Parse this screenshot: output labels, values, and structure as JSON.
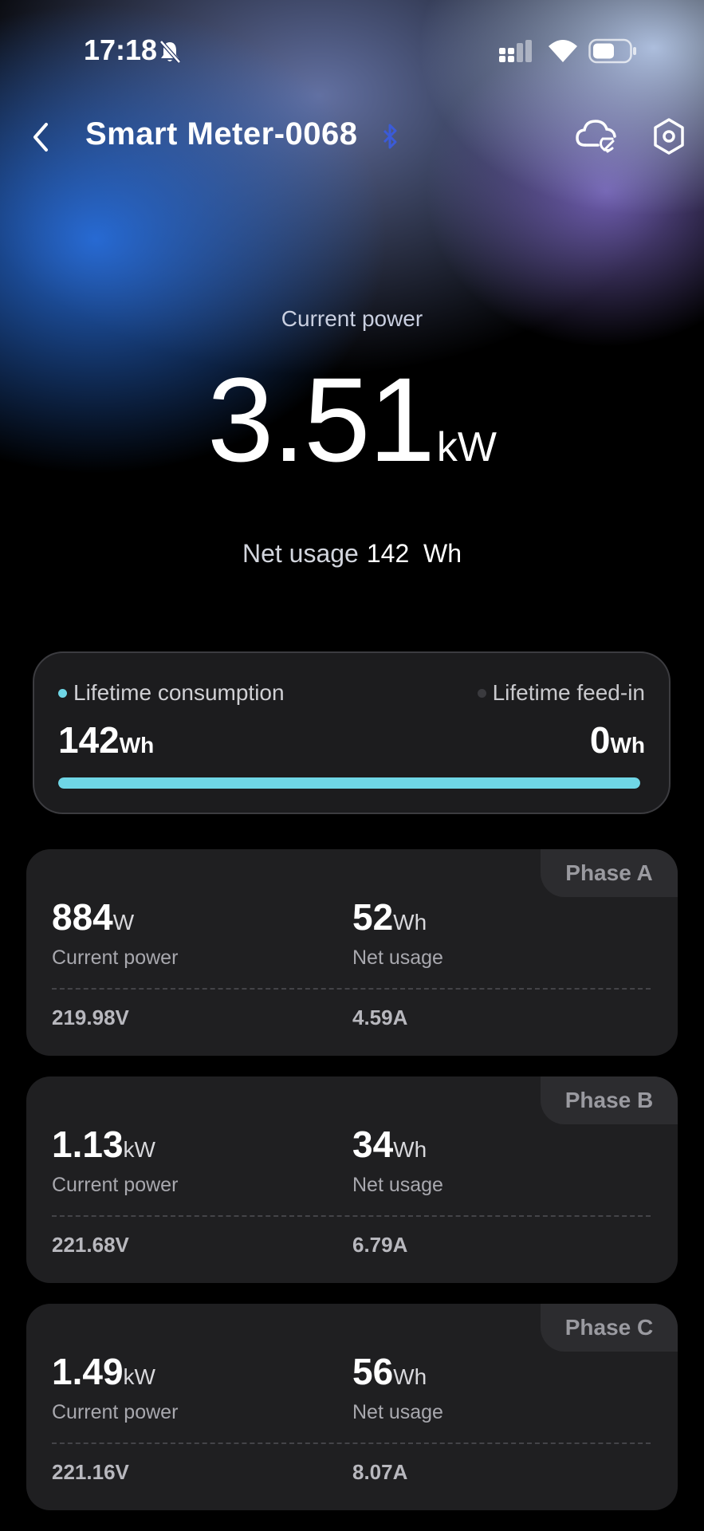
{
  "status_bar": {
    "time": "17:18",
    "icons": [
      "bell-muted-icon",
      "signal-icon",
      "wifi-icon",
      "battery-icon"
    ]
  },
  "header": {
    "title": "Smart Meter-0068",
    "icons": [
      "back-icon",
      "bluetooth-icon",
      "cloud-sync-icon",
      "settings-icon"
    ]
  },
  "hero": {
    "label": "Current power",
    "value": "3.51",
    "unit": "kW",
    "net_usage_label": "Net usage",
    "net_usage_value": "142  Wh"
  },
  "lifetime": {
    "consumption_label": "Lifetime consumption",
    "consumption_value": "142",
    "consumption_unit": "Wh",
    "feedin_label": "Lifetime feed-in",
    "feedin_value": "0",
    "feedin_unit": "Wh",
    "consumption_fraction": 1.0,
    "colors": {
      "consumption": "#6fd6e6",
      "feedin": "#3a3a3e"
    }
  },
  "phases": [
    {
      "name": "Phase A",
      "power_value": "884",
      "power_unit": "W",
      "power_label": "Current power",
      "net_value": "52",
      "net_unit": "Wh",
      "net_label": "Net usage",
      "voltage": "219.98V",
      "current": "4.59A"
    },
    {
      "name": "Phase B",
      "power_value": "1.13",
      "power_unit": "kW",
      "power_label": "Current power",
      "net_value": "34",
      "net_unit": "Wh",
      "net_label": "Net usage",
      "voltage": "221.68V",
      "current": "6.79A"
    },
    {
      "name": "Phase C",
      "power_value": "1.49",
      "power_unit": "kW",
      "power_label": "Current power",
      "net_value": "56",
      "net_unit": "Wh",
      "net_label": "Net usage",
      "voltage": "221.16V",
      "current": "8.07A"
    }
  ]
}
